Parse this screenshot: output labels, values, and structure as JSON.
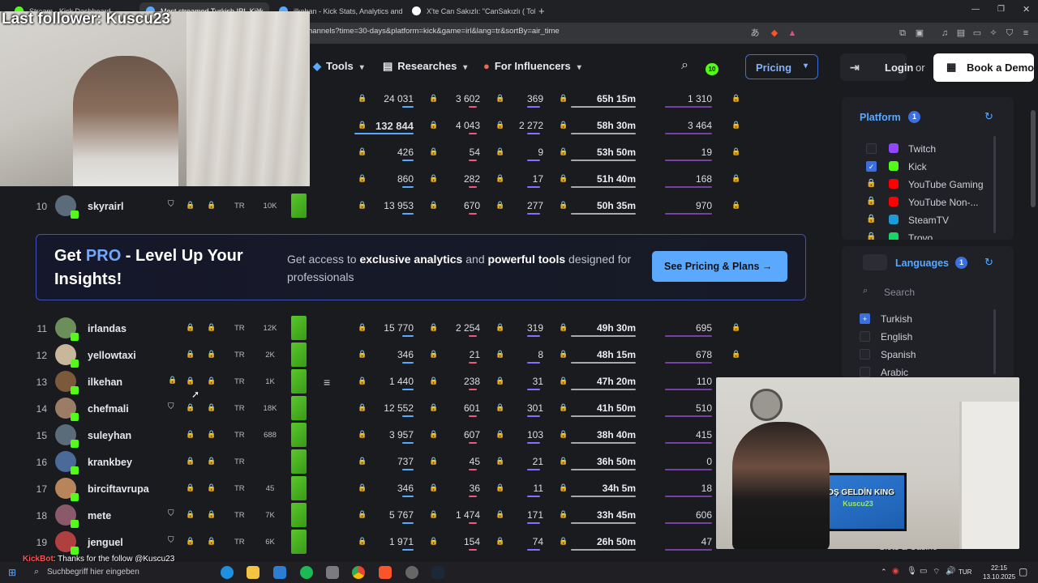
{
  "browser": {
    "tabs": [
      {
        "label": "Stream - Kick Dashboard",
        "active": false
      },
      {
        "label": "Most streamed Turkish IRL Kick",
        "active": true
      },
      {
        "label": "ilkehan - Kick Stats, Analytics and Ch",
        "active": false
      },
      {
        "label": "X'te Can Sakızlı: \"CanSakızlı ( Toksic",
        "active": false
      }
    ],
    "url": "hannels?time=30-days&platform=kick&game=irl&lang=tr&sortBy=air_time"
  },
  "nav": {
    "tools": "Tools",
    "researches": "Researches",
    "influencers": "For Influencers",
    "notif_count": "10",
    "pricing": "Pricing",
    "login": "Login",
    "or": "or",
    "demo": "Book a Demo"
  },
  "table_top": [
    {
      "rank": "",
      "name": "",
      "lang": "",
      "followers": "",
      "avg": "24 031",
      "peak": "3 602",
      "chat": "369",
      "air": "65h 15m",
      "last": "1 310",
      "locked_last": true,
      "big": false
    },
    {
      "rank": "",
      "name": "",
      "lang": "",
      "followers": "",
      "avg": "132 844",
      "peak": "4 043",
      "chat": "2 272",
      "air": "58h 30m",
      "last": "3 464",
      "locked_last": true,
      "big": true
    },
    {
      "rank": "",
      "name": "",
      "lang": "",
      "followers": "",
      "avg": "426",
      "peak": "54",
      "chat": "9",
      "air": "53h 50m",
      "last": "19",
      "locked_last": true,
      "big": false
    },
    {
      "rank": "",
      "name": "",
      "lang": "",
      "followers": "",
      "avg": "860",
      "peak": "282",
      "chat": "17",
      "air": "51h 40m",
      "last": "168",
      "locked_last": true,
      "big": false
    },
    {
      "rank": "10",
      "name": "skyrairl",
      "lang": "TR",
      "followers": "10K",
      "avg": "13 953",
      "peak": "670",
      "chat": "277",
      "air": "50h 35m",
      "last": "970",
      "locked_last": true,
      "big": false
    }
  ],
  "promo": {
    "title_pre": "Get ",
    "title_pro": "PRO",
    "title_post": " - Level Up Your Insights!",
    "desc_1": "Get access to ",
    "desc_b1": "exclusive analytics",
    "desc_2": " and ",
    "desc_b2": "powerful tools",
    "desc_3": " designed for professionals",
    "button": "See Pricing & Plans →"
  },
  "table_bottom": [
    {
      "rank": "11",
      "name": "irlandas",
      "lang": "TR",
      "followers": "12K",
      "avg": "15 770",
      "peak": "2 254",
      "chat": "319",
      "air": "49h 30m",
      "last": "695",
      "verified": false
    },
    {
      "rank": "12",
      "name": "yellowtaxi",
      "lang": "TR",
      "followers": "2K",
      "avg": "346",
      "peak": "21",
      "chat": "8",
      "air": "48h 15m",
      "last": "678",
      "verified": false
    },
    {
      "rank": "13",
      "name": "ilkehan",
      "lang": "TR",
      "followers": "1K",
      "avg": "1 440",
      "peak": "238",
      "chat": "31",
      "air": "47h 20m",
      "last": "110",
      "verified": false
    },
    {
      "rank": "14",
      "name": "chefmali",
      "lang": "TR",
      "followers": "18K",
      "avg": "12 552",
      "peak": "601",
      "chat": "301",
      "air": "41h 50m",
      "last": "510",
      "verified": true
    },
    {
      "rank": "15",
      "name": "suleyhan",
      "lang": "TR",
      "followers": "688",
      "avg": "3 957",
      "peak": "607",
      "chat": "103",
      "air": "38h 40m",
      "last": "415",
      "verified": false
    },
    {
      "rank": "16",
      "name": "krankbey",
      "lang": "TR",
      "followers": "",
      "avg": "737",
      "peak": "45",
      "chat": "21",
      "air": "36h 50m",
      "last": "0",
      "verified": false
    },
    {
      "rank": "17",
      "name": "birciftavrupa",
      "lang": "TR",
      "followers": "45",
      "avg": "346",
      "peak": "36",
      "chat": "11",
      "air": "34h 5m",
      "last": "18",
      "verified": false
    },
    {
      "rank": "18",
      "name": "mete",
      "lang": "TR",
      "followers": "7K",
      "avg": "5 767",
      "peak": "1 474",
      "chat": "171",
      "air": "33h 45m",
      "last": "606",
      "verified": true
    },
    {
      "rank": "19",
      "name": "jenguel",
      "lang": "TR",
      "followers": "6K",
      "avg": "1 971",
      "peak": "154",
      "chat": "74",
      "air": "26h 50m",
      "last": "47",
      "verified": true
    }
  ],
  "sidebar": {
    "platform": {
      "title": "Platform",
      "count": "1",
      "options": [
        {
          "label": "Twitch",
          "state": "off",
          "color": "#9146ff"
        },
        {
          "label": "Kick",
          "state": "on",
          "color": "#53fc18"
        },
        {
          "label": "YouTube Gaming",
          "state": "locked",
          "color": "#ff0000"
        },
        {
          "label": "YouTube Non-...",
          "state": "locked",
          "color": "#ff0000"
        },
        {
          "label": "SteamTV",
          "state": "locked",
          "color": "#1b9bd7"
        },
        {
          "label": "Trovo",
          "state": "locked",
          "color": "#19d66b"
        }
      ]
    },
    "languages": {
      "title": "Languages",
      "count": "1",
      "search_placeholder": "Search",
      "options": [
        {
          "label": "Turkish",
          "state": "on"
        },
        {
          "label": "English",
          "state": "off"
        },
        {
          "label": "Spanish",
          "state": "off"
        },
        {
          "label": "Arabic",
          "state": "off"
        }
      ]
    },
    "partial_label": "Slots & Casino"
  },
  "overlay": {
    "last_follower": "Last follower: Kuscu23",
    "tv_line1": "HOŞ GELDİN KING",
    "tv_line2": "Kuscu23",
    "chat_bot": "KickBot",
    "chat_msg": ": Thanks for the follow @Kuscu23"
  },
  "taskbar": {
    "search_placeholder": "Suchbegriff hier eingeben",
    "lang": "TUR",
    "time": "22:15",
    "date": "13.10.2025"
  }
}
